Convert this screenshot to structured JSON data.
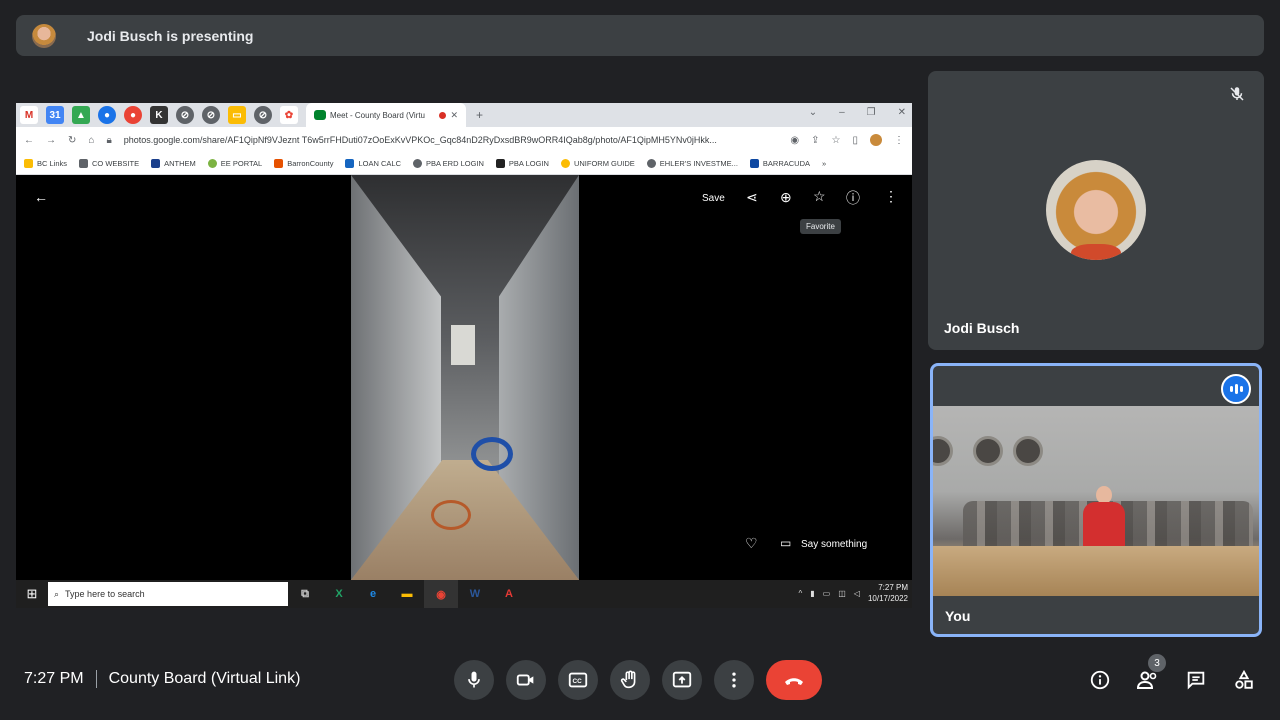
{
  "banner": {
    "text": "Jodi Busch is presenting"
  },
  "browser": {
    "active_tab_title": "Meet - County Board (Virtu",
    "url": "photos.google.com/share/AF1QipNf9VJeznt T6w5rrFHDuti07zOoExKvVPKOc_Gqc84nD2RyDxsdBR9wORR4IQab8g/photo/AF1QipMH5YNv0jHkk...",
    "bookmarks": [
      "BC Links",
      "CO WEBSITE",
      "ANTHEM",
      "EE PORTAL",
      "BarronCounty",
      "LOAN CALC",
      "PBA ERD LOGIN",
      "PBA LOGIN",
      "UNIFORM GUIDE",
      "EHLER'S INVESTME...",
      "BARRACUDA"
    ]
  },
  "viewer": {
    "save_label": "Save",
    "tooltip": "Favorite",
    "comment_label": "Say something"
  },
  "taskbar": {
    "search_placeholder": "Type here to search",
    "time": "7:27 PM",
    "date": "10/17/2022"
  },
  "participants": {
    "presenter_name": "Jodi Busch",
    "self_name": "You"
  },
  "meeting": {
    "time": "7:27 PM",
    "title": "County Board (Virtual Link)",
    "participant_count": "3"
  },
  "colors": {
    "background": "#202124",
    "tile": "#3c4043",
    "accent": "#8ab4f8",
    "end_call": "#ea4335"
  }
}
